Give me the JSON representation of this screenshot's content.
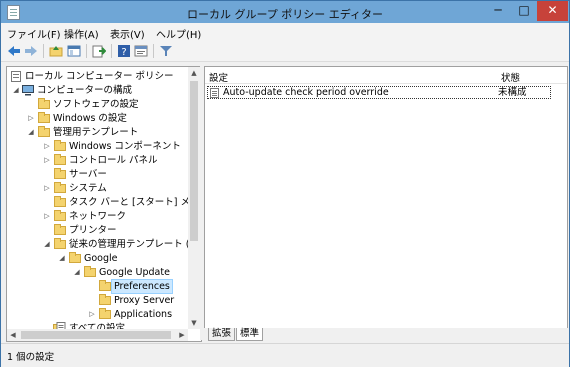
{
  "window": {
    "title": "ローカル グループ ポリシー エディター",
    "minimize": "─",
    "maximize": "□",
    "close": "✕"
  },
  "menu": [
    {
      "label": "ファイル(F)"
    },
    {
      "label": "操作(A)"
    },
    {
      "label": "表示(V)"
    },
    {
      "label": "ヘルプ(H)"
    }
  ],
  "toolbar": {
    "icons": [
      "back-arrow-icon",
      "forward-arrow-icon",
      "up-folder-icon",
      "show-hide-tree-icon",
      "export-list-icon",
      "help-icon",
      "properties-icon",
      "filter-icon"
    ]
  },
  "tree": {
    "items": [
      {
        "label": "ローカル コンピューター ポリシー",
        "expander": ""
      },
      {
        "label": "コンピューターの構成",
        "expander": "◢"
      },
      {
        "label": "ソフトウェアの設定",
        "expander": ""
      },
      {
        "label": "Windows の設定",
        "expander": "▷"
      },
      {
        "label": "管理用テンプレート",
        "expander": "◢"
      },
      {
        "label": "Windows コンポーネント",
        "expander": "▷"
      },
      {
        "label": "コントロール パネル",
        "expander": "▷"
      },
      {
        "label": "サーバー",
        "expander": ""
      },
      {
        "label": "システム",
        "expander": "▷"
      },
      {
        "label": "タスク バーと [スタート] メニュー",
        "expander": ""
      },
      {
        "label": "ネットワーク",
        "expander": "▷"
      },
      {
        "label": "プリンター",
        "expander": ""
      },
      {
        "label": "従来の管理用テンプレート (AD",
        "expander": "◢"
      },
      {
        "label": "Google",
        "expander": "◢"
      },
      {
        "label": "Google Update",
        "expander": "◢"
      },
      {
        "label": "Preferences",
        "expander": ""
      },
      {
        "label": "Proxy Server",
        "expander": ""
      },
      {
        "label": "Applications",
        "expander": "▷"
      },
      {
        "label": "すべての設定",
        "expander": ""
      }
    ]
  },
  "list": {
    "columns": {
      "setting": "設定",
      "state": "状態"
    },
    "rows": [
      {
        "name": "Auto-update check period override",
        "state": "未構成"
      }
    ]
  },
  "tabs": [
    {
      "label": "拡張"
    },
    {
      "label": "標準"
    }
  ],
  "status": {
    "text": "1 個の設定"
  },
  "colors": {
    "titlebar": "#6fa6d6",
    "selection": "#cce8ff",
    "close": "#c7423a"
  }
}
